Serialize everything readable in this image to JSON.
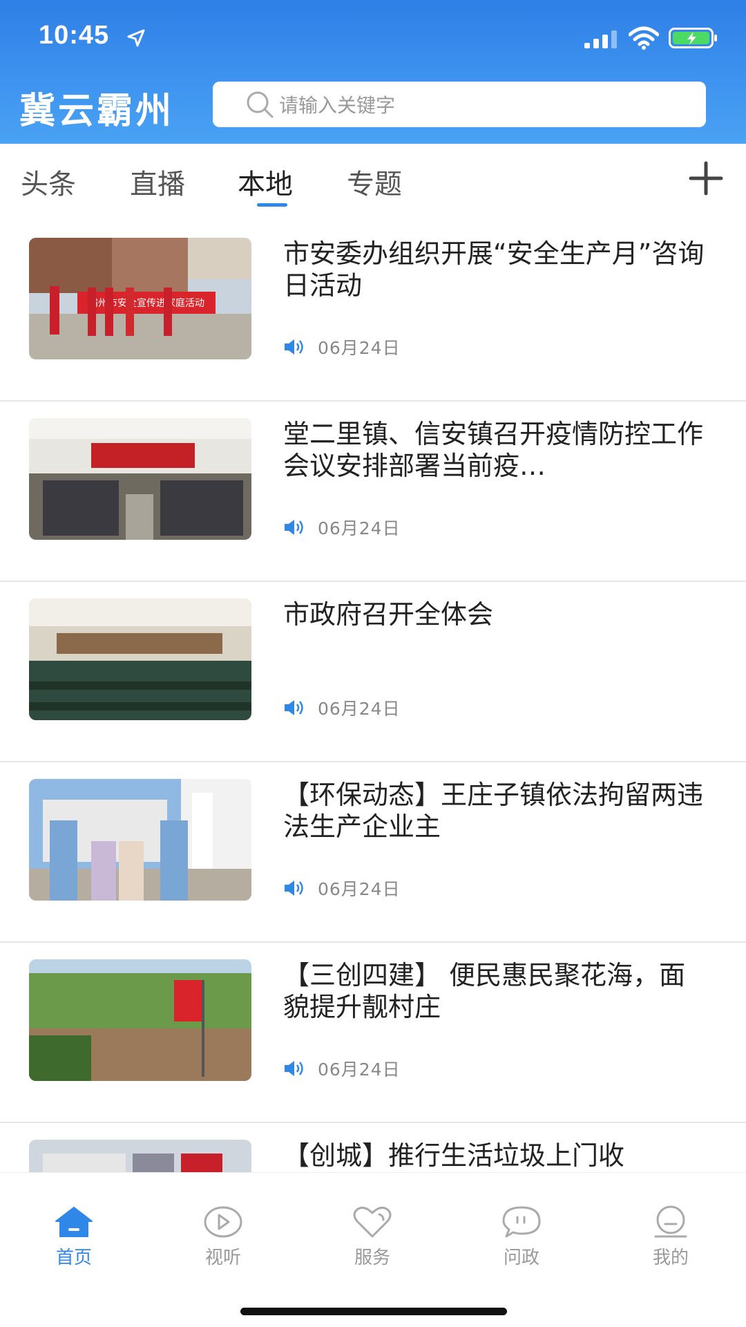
{
  "status_bar": {
    "time": "10:45"
  },
  "header": {
    "logo": "冀云霸州",
    "search_placeholder": "请输入关键字"
  },
  "tabs": [
    {
      "label": "头条",
      "active": false
    },
    {
      "label": "直播",
      "active": false
    },
    {
      "label": "本地",
      "active": true
    },
    {
      "label": "专题",
      "active": false
    }
  ],
  "news": [
    {
      "title": "市安委办组织开展“安全生产月”咨询日活动",
      "date": "06月24日",
      "banner": "霸州市安全宣传进家庭活动"
    },
    {
      "title": "堂二里镇、信安镇召开疫情防控工作会议安排部署当前疫…",
      "date": "06月24日"
    },
    {
      "title": "市政府召开全体会",
      "date": "06月24日"
    },
    {
      "title": "【环保动态】王庄子镇依法拘留两违法生产企业主",
      "date": "06月24日"
    },
    {
      "title": "【三创四建】 便民惠民聚花海，面貌提升靓村庄",
      "date": "06月24日"
    },
    {
      "title": "【创城】推行生活垃圾上门收",
      "date": ""
    }
  ],
  "bottom_nav": [
    {
      "label": "首页",
      "icon": "home-icon",
      "active": true
    },
    {
      "label": "视听",
      "icon": "play-icon",
      "active": false
    },
    {
      "label": "服务",
      "icon": "heart-icon",
      "active": false
    },
    {
      "label": "问政",
      "icon": "chat-icon",
      "active": false
    },
    {
      "label": "我的",
      "icon": "profile-icon",
      "active": false
    }
  ],
  "colors": {
    "accent": "#2f87e8",
    "header_top": "#2f7fe6",
    "header_bottom": "#4aa2f3"
  }
}
